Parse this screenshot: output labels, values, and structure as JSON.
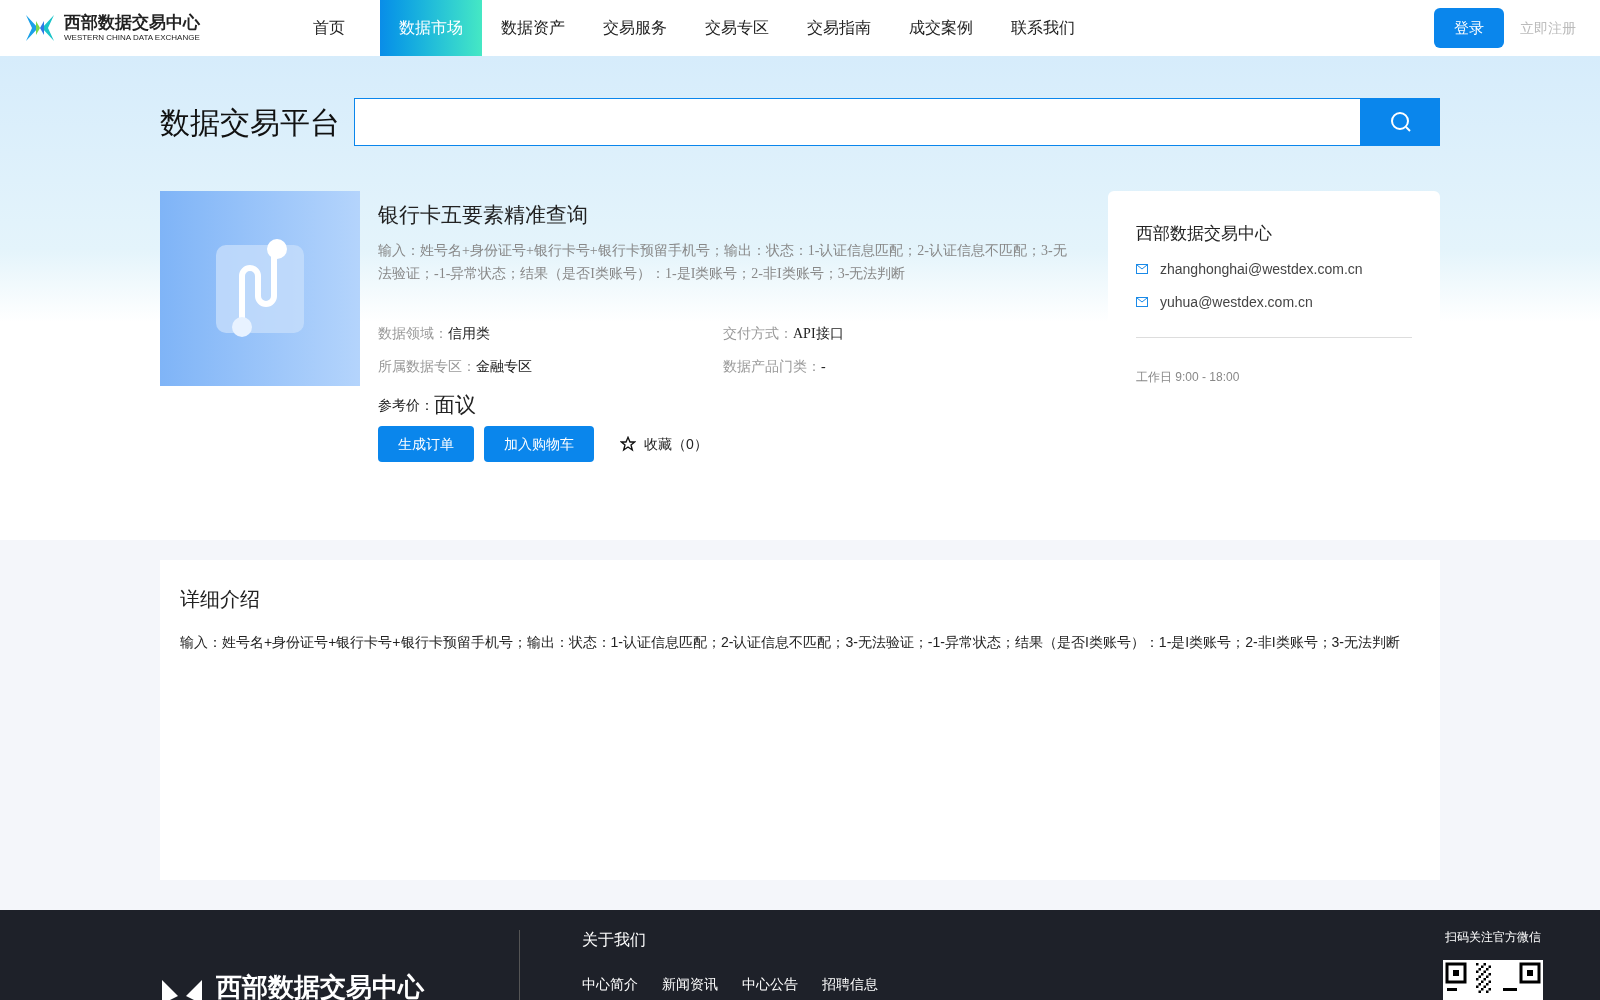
{
  "header": {
    "logo": {
      "name": "西部数据交易中心",
      "subtitle": "WESTERN CHINA DATA EXCHANGE"
    },
    "nav": [
      {
        "label": "首页",
        "selected": false
      },
      {
        "label": "数据市场",
        "selected": true
      },
      {
        "label": "数据资产",
        "selected": false
      },
      {
        "label": "交易服务",
        "selected": false
      },
      {
        "label": "交易专区",
        "selected": false
      },
      {
        "label": "交易指南",
        "selected": false
      },
      {
        "label": "成交案例",
        "selected": false
      },
      {
        "label": "联系我们",
        "selected": false
      }
    ],
    "login": "登录",
    "register": "立即注册"
  },
  "search": {
    "title": "数据交易平台"
  },
  "product": {
    "title": "银行卡五要素精准查询",
    "summary": "输入：姓号名+身份证号+银行卡号+银行卡预留手机号；输出：状态：1-认证信息匹配；2-认证信息不匹配；3-无法验证；-1-异常状态；结果（是否I类账号）：1-是I类账号；2-非I类账号；3-无法判断",
    "attributes": [
      {
        "label": "数据领域：",
        "value": "信用类"
      },
      {
        "label": "交付方式：",
        "value": "API接口"
      },
      {
        "label": "所属数据专区：",
        "value": "金融专区"
      },
      {
        "label": "数据产品门类：",
        "value": "-"
      }
    ],
    "price_label": "参考价：",
    "price": "面议",
    "buttons": [
      "生成订单",
      "加入购物车"
    ],
    "favorite": "收藏（0）"
  },
  "contact": {
    "name": "西部数据交易中心",
    "emails": [
      "zhanghonghai@westdex.com.cn",
      "yuhua@westdex.com.cn"
    ],
    "hours": "工作日 9:00 - 18:00"
  },
  "detail": {
    "title": "详细介绍",
    "text": "输入：姓号名+身份证号+银行卡号+银行卡预留手机号；输出：状态：1-认证信息匹配；2-认证信息不匹配；3-无法验证；-1-异常状态；结果（是否I类账号）：1-是I类账号；2-非I类账号；3-无法判断"
  },
  "footer": {
    "logo": "西部数据交易中心",
    "about_title": "关于我们",
    "links": [
      "中心简介",
      "新闻资讯",
      "中心公告",
      "招聘信息"
    ],
    "qr_label": "扫码关注官方微信"
  }
}
